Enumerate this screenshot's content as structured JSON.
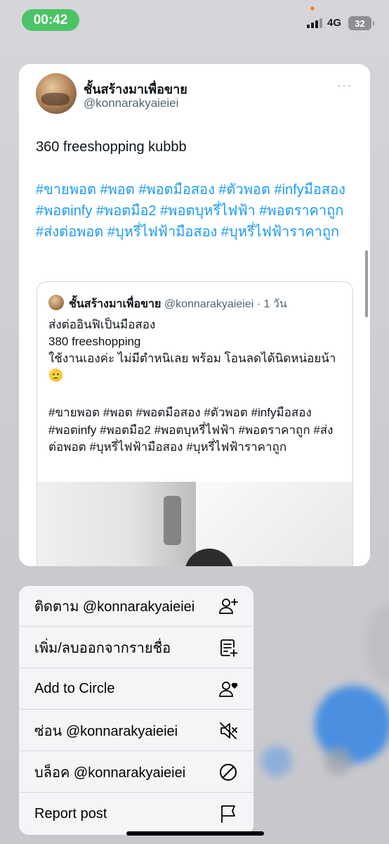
{
  "status_bar": {
    "time": "00:42",
    "network": "4G",
    "battery": "32"
  },
  "post": {
    "display_name": "ชั้นสร้างมาเพื่อขาย",
    "handle": "@konnarakyaieiei",
    "more": "···",
    "text": "360 freeshopping kubbb",
    "hashtags": "#ขายพอต #พอต #พอตมือสอง #ตัวพอต #infyมือสอง #พอตinfy #พอตมือ2 #พอตบุหรี่ไฟฟ้า #พอตราคาถูก #ส่งต่อพอต #บุหรี่ไฟฟ้ามือสอง #บุหรี่ไฟฟ้าราคาถูก"
  },
  "quoted_post": {
    "display_name": "ชั้นสร้างมาเพื่อขาย",
    "handle": "@konnarakyaieiei",
    "time": "· 1 วัน",
    "line1": "ส่งต่ออินฟิเป็นมือสอง",
    "line2": "380 freeshopping",
    "line3": "ใช้งานเองค่ะ ไม่มีตำหนิเลย พร้อม โอนลดได้นิดหน่อยน้า 🫡",
    "hashtags": "#ขายพอต #พอต #พอตมือสอง #ตัวพอต #infyมือสอง #พอตinfy #พอตมือ2 #พอตบุหรี่ไฟฟ้า #พอตราคาถูก #ส่งต่อพอต #บุหรี่ไฟฟ้ามือสอง #บุหรี่ไฟฟ้าราคาถูก"
  },
  "menu": {
    "items": [
      {
        "label": "ติดตาม @konnarakyaieiei",
        "icon": "follow-icon"
      },
      {
        "label": "เพิ่ม/ลบออกจากรายชื่อ",
        "icon": "list-add-icon"
      },
      {
        "label": "Add to Circle",
        "icon": "circle-add-icon"
      },
      {
        "label": "ซ่อน @konnarakyaieiei",
        "icon": "mute-icon"
      },
      {
        "label": "บล็อค @konnarakyaieiei",
        "icon": "block-icon"
      },
      {
        "label": "Report post",
        "icon": "flag-icon"
      }
    ]
  },
  "colors": {
    "accent": "#1d9bf0",
    "time_pill": "#4cc466"
  }
}
